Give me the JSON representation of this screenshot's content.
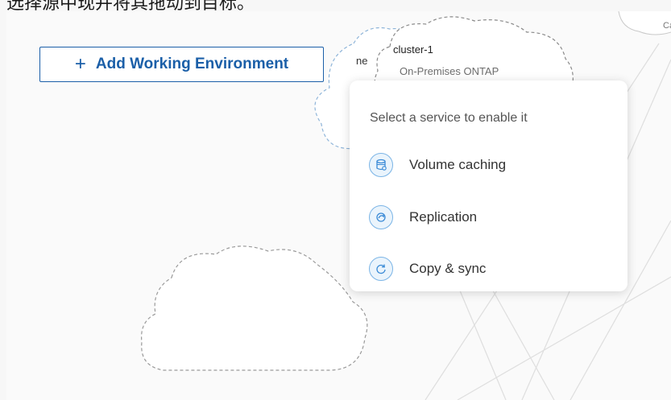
{
  "caption": "选择源中现并将其拖动到目标。",
  "toolbar": {
    "add_label": "Add Working Environment",
    "add_icon": "plus-icon"
  },
  "canvas": {
    "cluster": {
      "name": "cluster-1",
      "type": "On-Premises ONTAP"
    },
    "partial_label": "ne",
    "top_right_label": "Capa"
  },
  "service_menu": {
    "title": "Select a service to enable it",
    "items": [
      {
        "label": "Volume caching",
        "icon": "volume-caching-icon"
      },
      {
        "label": "Replication",
        "icon": "replication-icon"
      },
      {
        "label": "Copy & sync",
        "icon": "copy-sync-icon"
      }
    ]
  },
  "colors": {
    "accent": "#1b5fa8",
    "icon_ring": "#7ab4e6",
    "icon_fill": "#eaf4fc"
  }
}
